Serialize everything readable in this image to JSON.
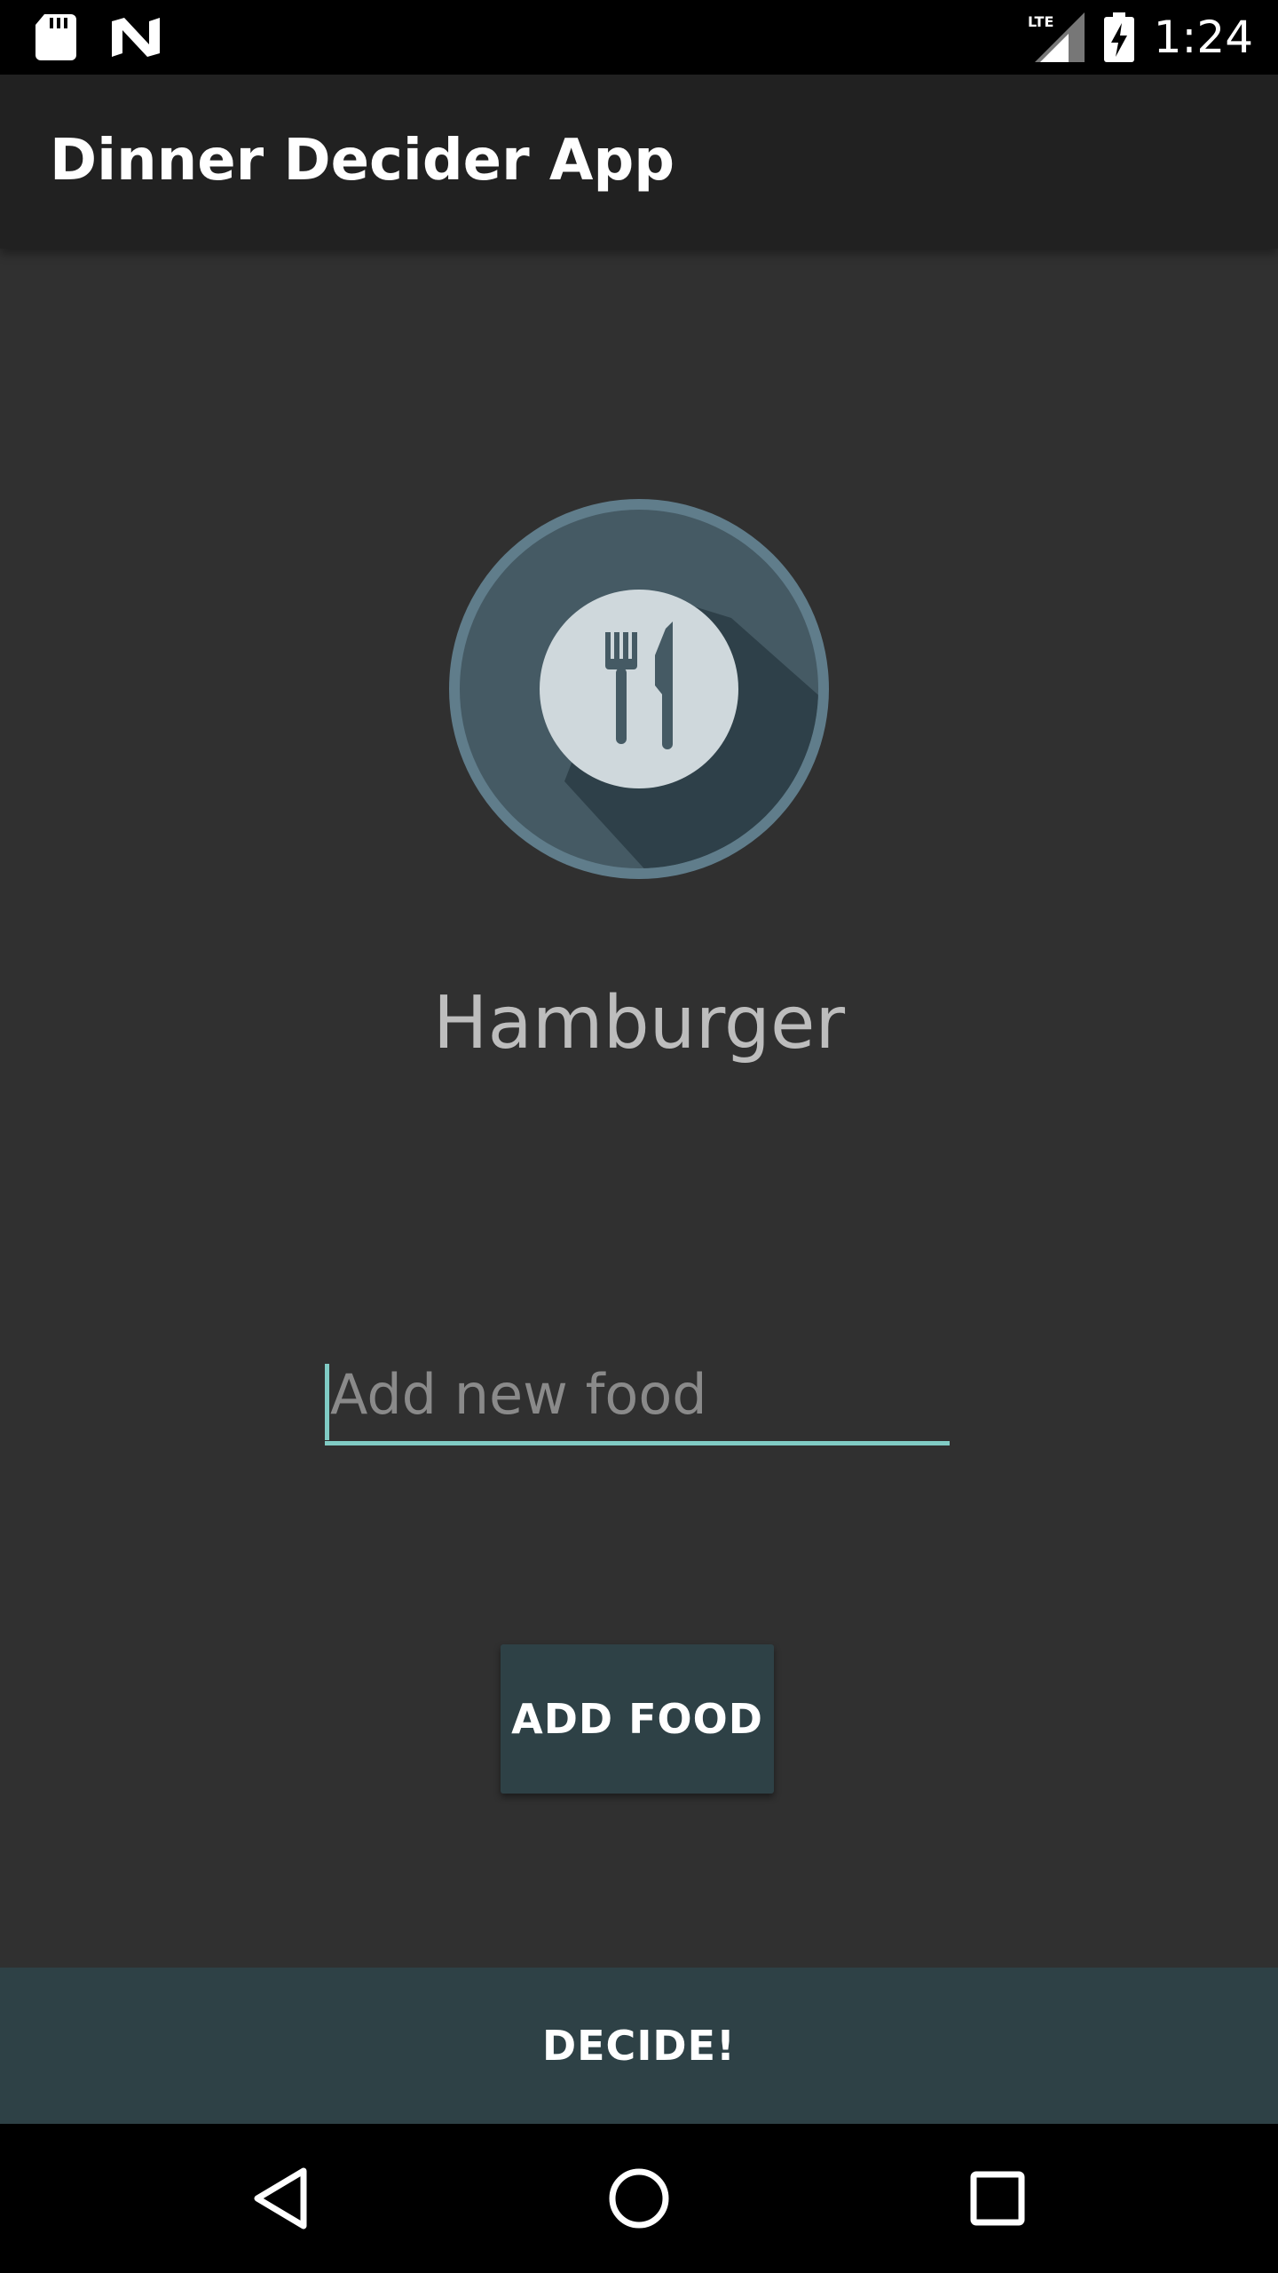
{
  "status_bar": {
    "time": "1:24",
    "network": "LTE",
    "icons": [
      "sd-card-icon",
      "n-notification-icon",
      "lte-signal-icon",
      "battery-charging-icon"
    ]
  },
  "app_bar": {
    "title": "Dinner Decider App"
  },
  "logo": {
    "icon": "plate-fork-knife-icon",
    "colors": {
      "outer": "#607d8b",
      "inner": "#455a64",
      "shadow": "#2e4049",
      "plate": "#cfd8dc"
    }
  },
  "main": {
    "selected_food": "Hamburger",
    "input": {
      "value": "",
      "placeholder": "Add new food"
    },
    "add_button_label": "ADD FOOD"
  },
  "decide_button_label": "DECIDE!",
  "nav_bar": {
    "icons": [
      "back-icon",
      "home-icon",
      "recents-icon"
    ]
  },
  "colors": {
    "background": "#303030",
    "app_bar": "#212121",
    "button": "#2e4146",
    "accent": "#80cbc4",
    "text_secondary": "#bdbdbd"
  }
}
